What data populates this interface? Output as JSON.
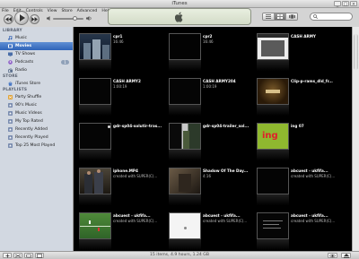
{
  "app": {
    "title": "iTunes"
  },
  "window_controls": {
    "minimize": "_",
    "maximize": "□",
    "close": "×"
  },
  "menu": [
    "File",
    "Edit",
    "Controls",
    "View",
    "Store",
    "Advanced",
    "Help"
  ],
  "colors": {
    "selection": "#3d70c3",
    "sidebar_bg": "#d2d8e1",
    "grid_bg": "#000000"
  },
  "sidebar": {
    "library_heading": "LIBRARY",
    "library": [
      {
        "label": "Music",
        "icon": "music-note-icon"
      },
      {
        "label": "Movies",
        "icon": "film-icon",
        "selected": true
      },
      {
        "label": "TV Shows",
        "icon": "tv-icon"
      },
      {
        "label": "Podcasts",
        "icon": "podcast-icon",
        "badge": "1"
      },
      {
        "label": "Radio",
        "icon": "radio-icon"
      }
    ],
    "store_heading": "STORE",
    "store": [
      {
        "label": "iTunes Store",
        "icon": "store-icon"
      }
    ],
    "playlists_heading": "PLAYLISTS",
    "playlists": [
      {
        "label": "Party Shuffle",
        "icon": "party-shuffle-icon"
      },
      {
        "label": "90's Music",
        "icon": "smart-playlist-icon"
      },
      {
        "label": "Music Videos",
        "icon": "smart-playlist-icon"
      },
      {
        "label": "My Top Rated",
        "icon": "smart-playlist-icon"
      },
      {
        "label": "Recently Added",
        "icon": "smart-playlist-icon"
      },
      {
        "label": "Recently Played",
        "icon": "smart-playlist-icon"
      },
      {
        "label": "Top 25 Most Played",
        "icon": "smart-playlist-icon"
      }
    ]
  },
  "movies": [
    {
      "title": "cpr1",
      "sub": "16:46",
      "thumb": "city"
    },
    {
      "title": "cpr2",
      "sub": "16:46",
      "thumb": "black"
    },
    {
      "title": "CASH ARMY",
      "sub": "",
      "thumb": "panel"
    },
    {
      "title": "CASH ARMY2",
      "sub": "1:00:19",
      "thumb": "dark"
    },
    {
      "title": "CASH ARMY204",
      "sub": "1:00:19",
      "thumb": "dark"
    },
    {
      "title": "Clip-p-rams_dld_fr...",
      "sub": "",
      "thumb": "sign"
    },
    {
      "title": "gdr-sp04-solutir-tras...",
      "sub": "",
      "thumb": "dot"
    },
    {
      "title": "gdr-sp04-trailer_sol...",
      "sub": "",
      "thumb": "green"
    },
    {
      "title": "ing 07",
      "sub": "",
      "thumb": "ing"
    },
    {
      "title": "iphone.MP4",
      "sub": "created with SUPER(C)...",
      "thumb": "people"
    },
    {
      "title": "Shadow Of The Day...",
      "sub": "4:16",
      "thumb": "shadow"
    },
    {
      "title": "abcuest - ukfifa...",
      "sub": "created with SUPER(C)...",
      "thumb": "blank"
    },
    {
      "title": "abcuest - ukfifa...",
      "sub": "created with SUPER(C)...",
      "thumb": "soccer"
    },
    {
      "title": "abcuest - ukfifa...",
      "sub": "created with SUPER(C)...",
      "thumb": "white"
    },
    {
      "title": "abcuest - ukfifa...",
      "sub": "created with SUPER(C)...",
      "thumb": "menu"
    }
  ],
  "status": {
    "text": "15 items, 4.9 hours, 1.24 GB"
  }
}
